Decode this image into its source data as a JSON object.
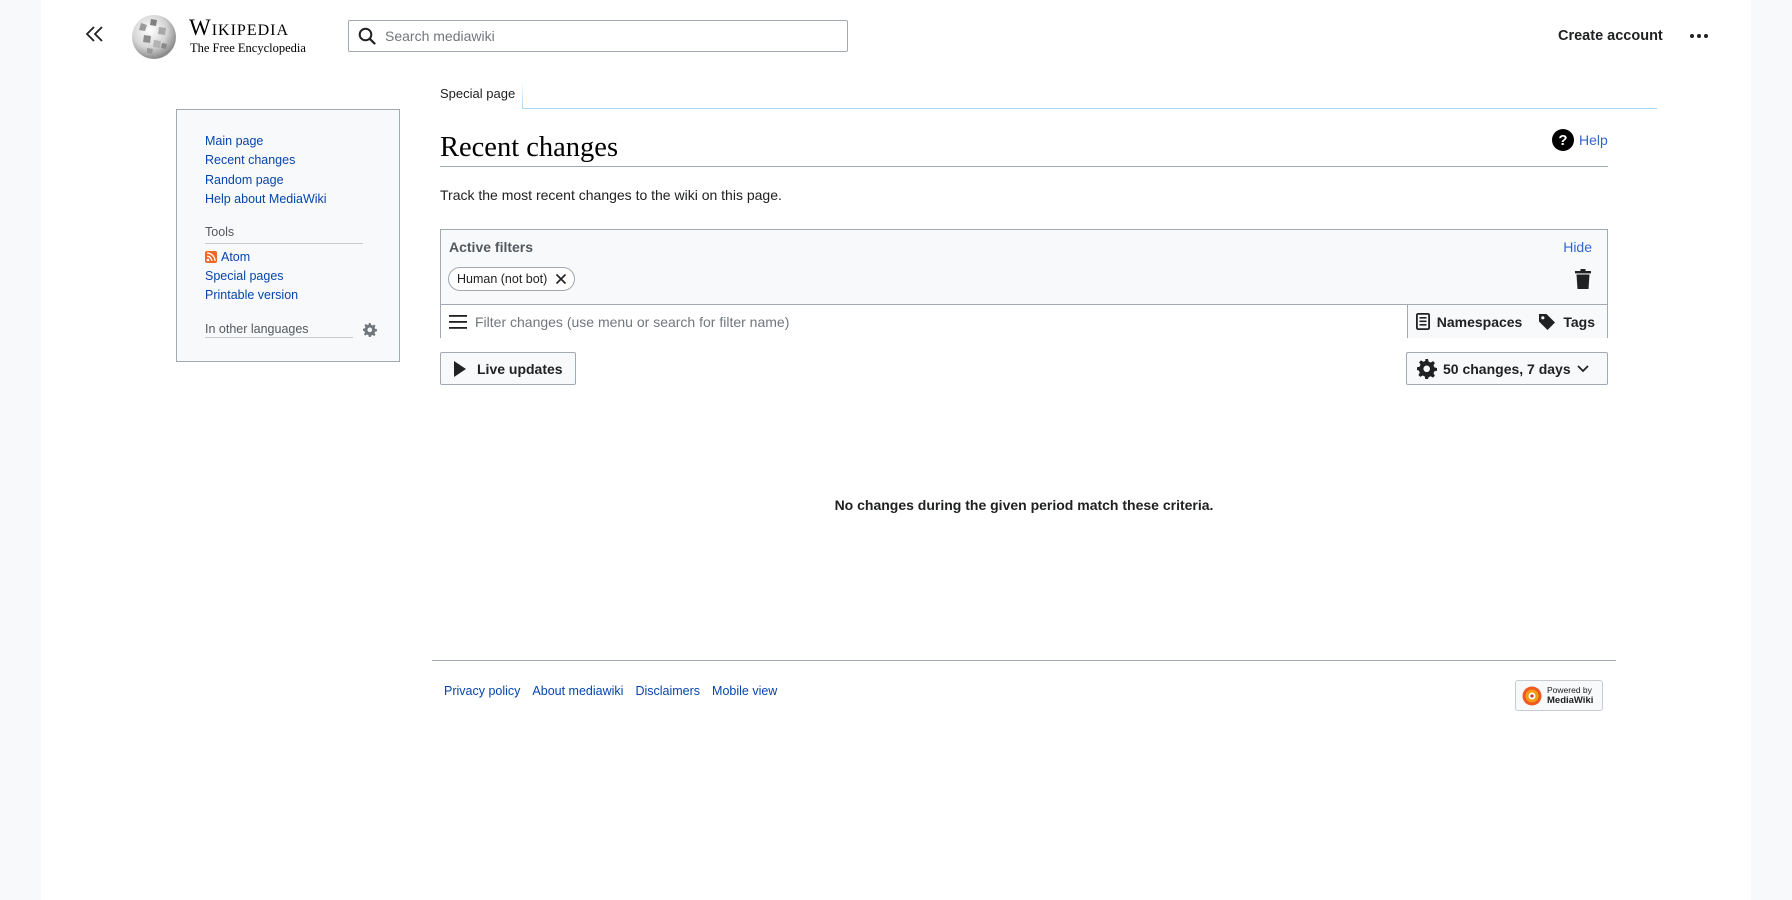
{
  "header": {
    "wordmark": "Wikipedia",
    "tagline": "The Free Encyclopedia",
    "search_placeholder": "Search mediawiki",
    "create_account": "Create account"
  },
  "sidebar": {
    "navigation": [
      {
        "label": "Main page"
      },
      {
        "label": "Recent changes"
      },
      {
        "label": "Random page"
      },
      {
        "label": "Help about MediaWiki"
      }
    ],
    "tools_title": "Tools",
    "tools": [
      {
        "label": "Atom",
        "icon": "atom-feed-icon"
      },
      {
        "label": "Special pages"
      },
      {
        "label": "Printable version"
      }
    ],
    "languages_title": "In other languages"
  },
  "tabs": {
    "special_page": "Special page"
  },
  "content": {
    "title": "Recent changes",
    "help": "Help",
    "intro": "Track the most recent changes to the wiki on this page.",
    "filters": {
      "active_label": "Active filters",
      "hide": "Hide",
      "pill": "Human (not bot)",
      "input_placeholder": "Filter changes (use menu or search for filter name)",
      "namespaces": "Namespaces",
      "tags": "Tags"
    },
    "live_updates": "Live updates",
    "period": "50 changes, 7 days",
    "no_changes": "No changes during the given period match these criteria."
  },
  "footer": {
    "links": [
      {
        "label": "Privacy policy"
      },
      {
        "label": "About mediawiki"
      },
      {
        "label": "Disclaimers"
      },
      {
        "label": "Mobile view"
      }
    ],
    "powered_line1": "Powered by",
    "powered_line2": "MediaWiki"
  },
  "colors": {
    "link": "#3366cc",
    "link_dark": "#0645ad",
    "border": "#a2a9b1",
    "panel": "#f8f9fa",
    "tab_border": "#a7d7f9"
  }
}
